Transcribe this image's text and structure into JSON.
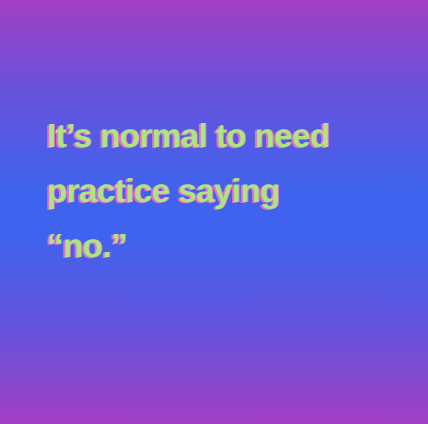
{
  "quote": {
    "lines": [
      "It’s normal to need",
      "practice saying",
      "“no.”"
    ]
  },
  "colors": {
    "text": "#a8e87e",
    "text_shadow": "#e06fd0",
    "gradient_edge": "#a23fc4",
    "gradient_center": "#3f63ee"
  }
}
